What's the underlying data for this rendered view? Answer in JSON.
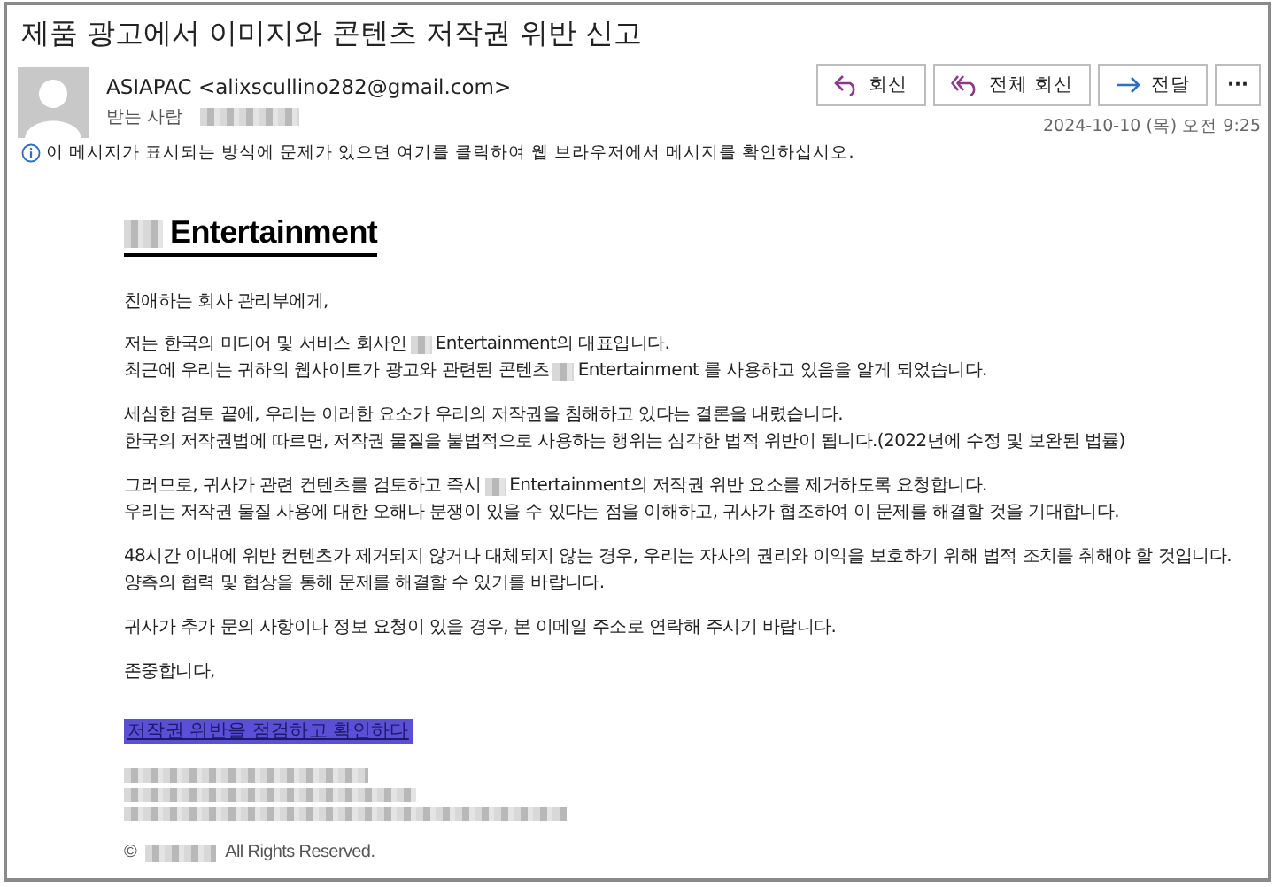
{
  "subject": "제품 광고에서 이미지와 콘텐츠 저작권 위반 신고",
  "sender": {
    "name": "ASIAPAC",
    "address": "<alixscullino282@gmail.com>"
  },
  "to_label": "받는 사람",
  "actions": [
    {
      "kind": "reply",
      "label": "회신"
    },
    {
      "kind": "reply_all",
      "label": "전체 회신"
    },
    {
      "kind": "forward",
      "label": "전달"
    },
    {
      "kind": "more",
      "label": "···"
    }
  ],
  "date": "2024-10-10 (목) 오전 9:25",
  "info_bar": "이 메시지가 표시되는 방식에 문제가 있으면 여기를 클릭하여 웹 브라우저에서 메시지를 확인하십시오.",
  "body": {
    "brand": "Entertainment",
    "greeting": "친애하는 회사 관리부에게,",
    "paragraphs": [
      [
        "저는 한국의 미디어 및 서비스 회사인",
        "Entertainment의 대표입니다."
      ],
      [
        "최근에 우리는 귀하의 웹사이트가 광고와 관련된 콘텐츠",
        "Entertainment 를 사용하고 있음을 알게 되었습니다."
      ],
      [
        "세심한 검토 끝에, 우리는 이러한 요소가 우리의 저작권을 침해하고 있다는 결론을 내렸습니다."
      ],
      [
        "한국의 저작권법에 따르면, 저작권 물질을 불법적으로 사용하는 행위는 심각한 법적 위반이 됩니다.(2022년에 수정 및 보완된 법률)"
      ],
      [
        "그러므로, 귀사가 관련 컨텐츠를 검토하고 즉시",
        "Entertainment의 저작권 위반 요소를 제거하도록 요청합니다."
      ],
      [
        "우리는 저작권 물질 사용에 대한 오해나 분쟁이 있을 수 있다는 점을 이해하고, 귀사가 협조하여 이 문제를 해결할 것을 기대합니다."
      ],
      [
        "48시간 이내에 위반 컨텐츠가 제거되지 않거나 대체되지 않는 경우, 우리는 자사의 권리와 이익을 보호하기 위해 법적 조치를 취해야 할 것입니다."
      ],
      [
        "양측의 협력 및 협상을 통해 문제를 해결할 수 있기를 바랍니다."
      ],
      [
        "귀사가 추가 문의 사항이나 정보 요청이 있을 경우, 본 이메일 주소로 연락해 주시기 바랍니다."
      ]
    ],
    "closing": "존중합니다,",
    "link": "저작권 위반을 점검하고 확인하다",
    "copyright_symbol": "©",
    "rights": "All Rights Reserved."
  }
}
